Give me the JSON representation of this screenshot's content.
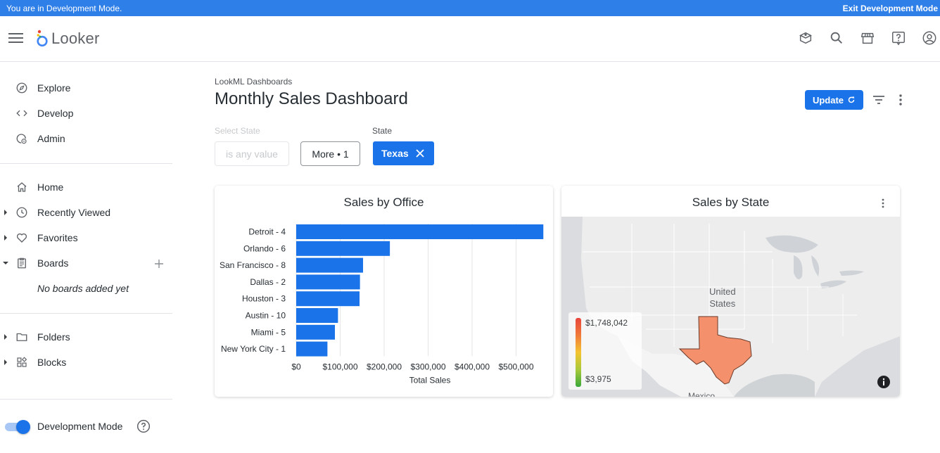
{
  "devbar": {
    "left": "You are in Development Mode.",
    "right": "Exit Development Mode"
  },
  "header": {
    "logo_text": "Looker",
    "icons": [
      "learn-icon",
      "search-icon",
      "marketplace-icon",
      "help-icon",
      "account-icon"
    ]
  },
  "sidebar": {
    "items": [
      {
        "label": "Explore",
        "icon": "compass-icon"
      },
      {
        "label": "Develop",
        "icon": "code-icon"
      },
      {
        "label": "Admin",
        "icon": "admin-icon"
      },
      {
        "label": "Home",
        "icon": "home-icon"
      },
      {
        "label": "Recently Viewed",
        "icon": "clock-icon"
      },
      {
        "label": "Favorites",
        "icon": "heart-icon"
      },
      {
        "label": "Boards",
        "icon": "board-icon"
      },
      {
        "label": "Folders",
        "icon": "folder-icon"
      },
      {
        "label": "Blocks",
        "icon": "blocks-icon"
      }
    ],
    "empty_boards": "No boards added yet",
    "dev_mode_label": "Development Mode",
    "dev_mode_on": true
  },
  "main": {
    "breadcrumb": "LookML Dashboards",
    "title": "Monthly Sales Dashboard",
    "update_label": "Update",
    "filters": {
      "select_state_label": "Select State",
      "select_state_value": "is any value",
      "more_label": "More • 1",
      "state_label": "State",
      "state_chip": "Texas"
    }
  },
  "tiles": {
    "office": {
      "title": "Sales by Office"
    },
    "state": {
      "title": "Sales by State",
      "legend_max": "$1,748,042",
      "legend_min": "$3,975",
      "map_label_country": "United States",
      "map_label_mexico": "Mexico",
      "highlight_color": "#f4906b"
    }
  },
  "chart_data": {
    "type": "bar",
    "orientation": "horizontal",
    "title": "Sales by Office",
    "xlabel": "Total Sales",
    "ylabel": "",
    "categories": [
      "Detroit - 4",
      "Orlando - 6",
      "San Francisco - 8",
      "Dallas - 2",
      "Houston - 3",
      "Austin - 10",
      "Miami - 5",
      "New York City - 1"
    ],
    "values": [
      562000,
      213000,
      152000,
      145000,
      144000,
      95000,
      88000,
      71000
    ],
    "xlim": [
      0,
      560000
    ],
    "xticks": [
      0,
      100000,
      200000,
      300000,
      400000,
      500000
    ],
    "xtick_labels": [
      "$0",
      "$100,000",
      "$200,000",
      "$300,000",
      "$400,000",
      "$500,000"
    ],
    "color": "#1a73e8",
    "grid": true
  }
}
